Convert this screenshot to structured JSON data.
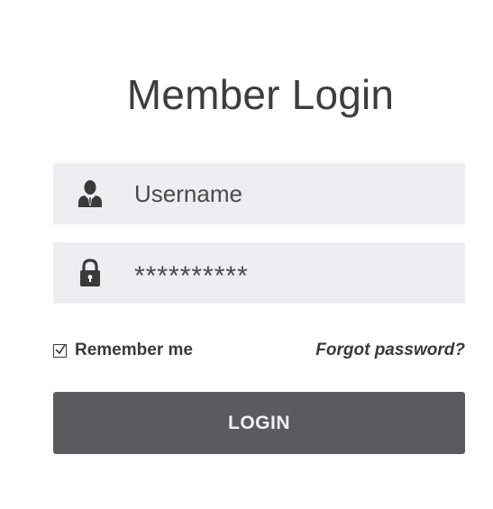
{
  "title": "Member Login",
  "username": {
    "icon": "user-icon",
    "placeholder": "Username"
  },
  "password": {
    "icon": "lock-icon",
    "value": "**********"
  },
  "remember": {
    "checked": true,
    "label": "Remember me"
  },
  "forgot_label": "Forgot password?",
  "login_label": "LOGIN",
  "colors": {
    "field_bg": "#eeeef2",
    "button_bg": "#5b5a5c",
    "text": "#3a3a3a"
  }
}
